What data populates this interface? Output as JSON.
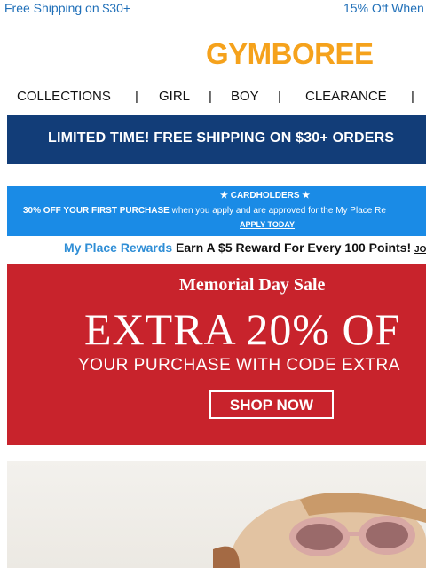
{
  "topbar": {
    "left_text": "Free Shipping on $30+",
    "right_text": "15% Off When"
  },
  "logo": {
    "text": "GYMBOREE"
  },
  "nav": {
    "items": [
      "COLLECTIONS",
      "GIRL",
      "BOY",
      "CLEARANCE"
    ],
    "separator": "|"
  },
  "shipping_banner": {
    "text": "LIMITED TIME! FREE SHIPPING ON $30+ ORDERS"
  },
  "card_banner": {
    "heading": "★ CARDHOLDERS ★",
    "offer_bold": "30% OFF YOUR FIRST PURCHASE",
    "offer_rest": " when you apply and are approved for the My Place Re",
    "cta": "APPLY TODAY"
  },
  "rewards": {
    "brand": "My Place Rewards",
    "message": " Earn A $5 Reward For Every 100 Points! ",
    "join": "JO"
  },
  "sale_banner": {
    "subtitle": "Memorial Day Sale",
    "headline": "EXTRA 20% OF",
    "line": "YOUR PURCHASE WITH CODE EXTRA",
    "cta": "SHOP NOW"
  },
  "colors": {
    "link_blue": "#1f6fb8",
    "logo_orange": "#f5a21c",
    "ship_navy": "#123d78",
    "card_blue": "#1a8be6",
    "sale_red": "#c8232c"
  }
}
